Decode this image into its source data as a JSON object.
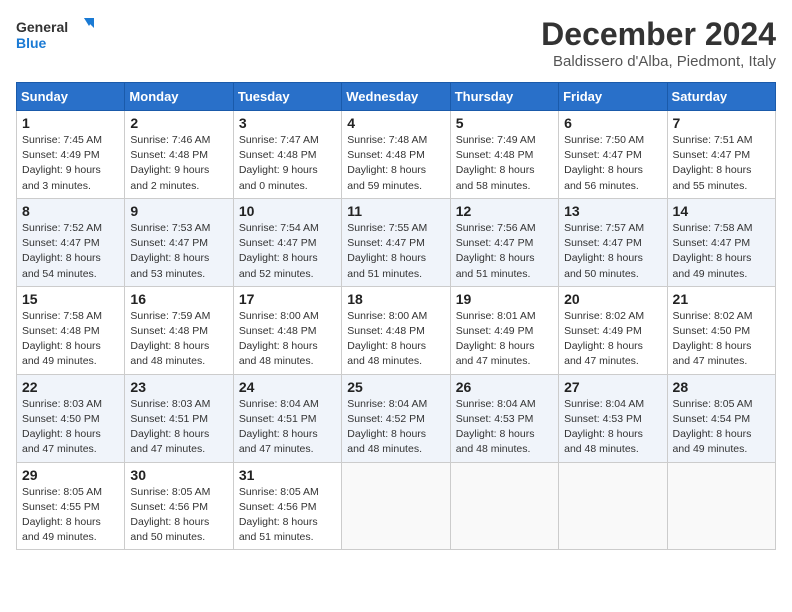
{
  "header": {
    "logo_line1": "General",
    "logo_line2": "Blue",
    "month_title": "December 2024",
    "location": "Baldissero d'Alba, Piedmont, Italy"
  },
  "weekdays": [
    "Sunday",
    "Monday",
    "Tuesday",
    "Wednesday",
    "Thursday",
    "Friday",
    "Saturday"
  ],
  "weeks": [
    [
      {
        "day": "1",
        "sunrise": "7:45 AM",
        "sunset": "4:49 PM",
        "daylight": "9 hours and 3 minutes."
      },
      {
        "day": "2",
        "sunrise": "7:46 AM",
        "sunset": "4:48 PM",
        "daylight": "9 hours and 2 minutes."
      },
      {
        "day": "3",
        "sunrise": "7:47 AM",
        "sunset": "4:48 PM",
        "daylight": "9 hours and 0 minutes."
      },
      {
        "day": "4",
        "sunrise": "7:48 AM",
        "sunset": "4:48 PM",
        "daylight": "8 hours and 59 minutes."
      },
      {
        "day": "5",
        "sunrise": "7:49 AM",
        "sunset": "4:48 PM",
        "daylight": "8 hours and 58 minutes."
      },
      {
        "day": "6",
        "sunrise": "7:50 AM",
        "sunset": "4:47 PM",
        "daylight": "8 hours and 56 minutes."
      },
      {
        "day": "7",
        "sunrise": "7:51 AM",
        "sunset": "4:47 PM",
        "daylight": "8 hours and 55 minutes."
      }
    ],
    [
      {
        "day": "8",
        "sunrise": "7:52 AM",
        "sunset": "4:47 PM",
        "daylight": "8 hours and 54 minutes."
      },
      {
        "day": "9",
        "sunrise": "7:53 AM",
        "sunset": "4:47 PM",
        "daylight": "8 hours and 53 minutes."
      },
      {
        "day": "10",
        "sunrise": "7:54 AM",
        "sunset": "4:47 PM",
        "daylight": "8 hours and 52 minutes."
      },
      {
        "day": "11",
        "sunrise": "7:55 AM",
        "sunset": "4:47 PM",
        "daylight": "8 hours and 51 minutes."
      },
      {
        "day": "12",
        "sunrise": "7:56 AM",
        "sunset": "4:47 PM",
        "daylight": "8 hours and 51 minutes."
      },
      {
        "day": "13",
        "sunrise": "7:57 AM",
        "sunset": "4:47 PM",
        "daylight": "8 hours and 50 minutes."
      },
      {
        "day": "14",
        "sunrise": "7:58 AM",
        "sunset": "4:47 PM",
        "daylight": "8 hours and 49 minutes."
      }
    ],
    [
      {
        "day": "15",
        "sunrise": "7:58 AM",
        "sunset": "4:48 PM",
        "daylight": "8 hours and 49 minutes."
      },
      {
        "day": "16",
        "sunrise": "7:59 AM",
        "sunset": "4:48 PM",
        "daylight": "8 hours and 48 minutes."
      },
      {
        "day": "17",
        "sunrise": "8:00 AM",
        "sunset": "4:48 PM",
        "daylight": "8 hours and 48 minutes."
      },
      {
        "day": "18",
        "sunrise": "8:00 AM",
        "sunset": "4:48 PM",
        "daylight": "8 hours and 48 minutes."
      },
      {
        "day": "19",
        "sunrise": "8:01 AM",
        "sunset": "4:49 PM",
        "daylight": "8 hours and 47 minutes."
      },
      {
        "day": "20",
        "sunrise": "8:02 AM",
        "sunset": "4:49 PM",
        "daylight": "8 hours and 47 minutes."
      },
      {
        "day": "21",
        "sunrise": "8:02 AM",
        "sunset": "4:50 PM",
        "daylight": "8 hours and 47 minutes."
      }
    ],
    [
      {
        "day": "22",
        "sunrise": "8:03 AM",
        "sunset": "4:50 PM",
        "daylight": "8 hours and 47 minutes."
      },
      {
        "day": "23",
        "sunrise": "8:03 AM",
        "sunset": "4:51 PM",
        "daylight": "8 hours and 47 minutes."
      },
      {
        "day": "24",
        "sunrise": "8:04 AM",
        "sunset": "4:51 PM",
        "daylight": "8 hours and 47 minutes."
      },
      {
        "day": "25",
        "sunrise": "8:04 AM",
        "sunset": "4:52 PM",
        "daylight": "8 hours and 48 minutes."
      },
      {
        "day": "26",
        "sunrise": "8:04 AM",
        "sunset": "4:53 PM",
        "daylight": "8 hours and 48 minutes."
      },
      {
        "day": "27",
        "sunrise": "8:04 AM",
        "sunset": "4:53 PM",
        "daylight": "8 hours and 48 minutes."
      },
      {
        "day": "28",
        "sunrise": "8:05 AM",
        "sunset": "4:54 PM",
        "daylight": "8 hours and 49 minutes."
      }
    ],
    [
      {
        "day": "29",
        "sunrise": "8:05 AM",
        "sunset": "4:55 PM",
        "daylight": "8 hours and 49 minutes."
      },
      {
        "day": "30",
        "sunrise": "8:05 AM",
        "sunset": "4:56 PM",
        "daylight": "8 hours and 50 minutes."
      },
      {
        "day": "31",
        "sunrise": "8:05 AM",
        "sunset": "4:56 PM",
        "daylight": "8 hours and 51 minutes."
      },
      null,
      null,
      null,
      null
    ]
  ]
}
